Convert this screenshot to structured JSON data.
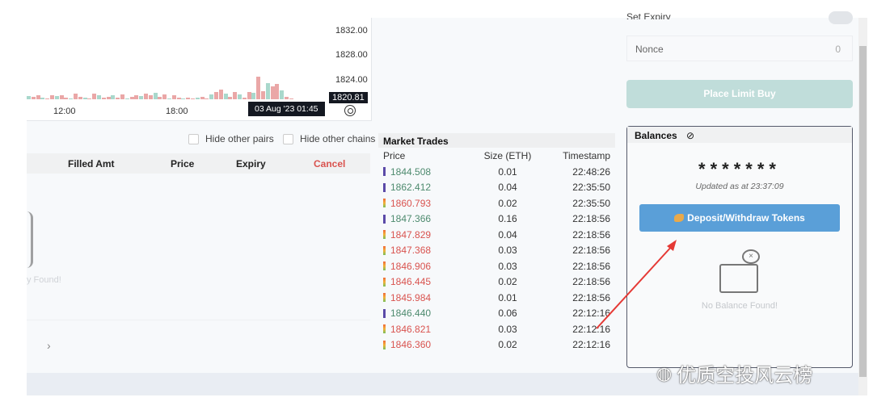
{
  "chart": {
    "y_ticks": [
      "1832.00",
      "1828.00",
      "1824.00"
    ],
    "x_ticks": [
      "12:00",
      "18:00"
    ],
    "crosshair_time": "03 Aug '23   01:45",
    "last_price": "1820.81",
    "colors": {
      "up": "#a9d8cc",
      "down": "#eaa7a7"
    }
  },
  "orders": {
    "hide_pairs": "Hide other pairs",
    "hide_chains": "Hide other chains",
    "columns": [
      "Filled Amt",
      "Price",
      "Expiry",
      "Cancel"
    ],
    "empty_partial": "y Found!",
    "next": "›"
  },
  "market_trades": {
    "title": "Market Trades",
    "columns": [
      "Price",
      "Size (ETH)",
      "Timestamp"
    ],
    "rows": [
      {
        "price": "1844.508",
        "size": "0.01",
        "time": "22:48:26",
        "side": "buy"
      },
      {
        "price": "1862.412",
        "size": "0.04",
        "time": "22:35:50",
        "side": "buy"
      },
      {
        "price": "1860.793",
        "size": "0.02",
        "time": "22:35:50",
        "side": "sell"
      },
      {
        "price": "1847.366",
        "size": "0.16",
        "time": "22:18:56",
        "side": "buy"
      },
      {
        "price": "1847.829",
        "size": "0.04",
        "time": "22:18:56",
        "side": "sell"
      },
      {
        "price": "1847.368",
        "size": "0.03",
        "time": "22:18:56",
        "side": "sell"
      },
      {
        "price": "1846.906",
        "size": "0.03",
        "time": "22:18:56",
        "side": "sell"
      },
      {
        "price": "1846.445",
        "size": "0.02",
        "time": "22:18:56",
        "side": "sell"
      },
      {
        "price": "1845.984",
        "size": "0.01",
        "time": "22:18:56",
        "side": "sell"
      },
      {
        "price": "1846.440",
        "size": "0.06",
        "time": "22:12:16",
        "side": "buy"
      },
      {
        "price": "1846.821",
        "size": "0.03",
        "time": "22:12:16",
        "side": "sell"
      },
      {
        "price": "1846.360",
        "size": "0.02",
        "time": "22:12:16",
        "side": "sell"
      }
    ]
  },
  "order_form": {
    "expiry_label": "Set Expiry",
    "nonce_label": "Nonce",
    "nonce_value": "0",
    "place_button": "Place Limit Buy"
  },
  "balances": {
    "title": "Balances",
    "masked": "*******",
    "updated": "Updated as at 23:37:09",
    "deposit_button": "Deposit/Withdraw Tokens",
    "empty": "No Balance Found!"
  },
  "watermark": "优质空投风云榜"
}
